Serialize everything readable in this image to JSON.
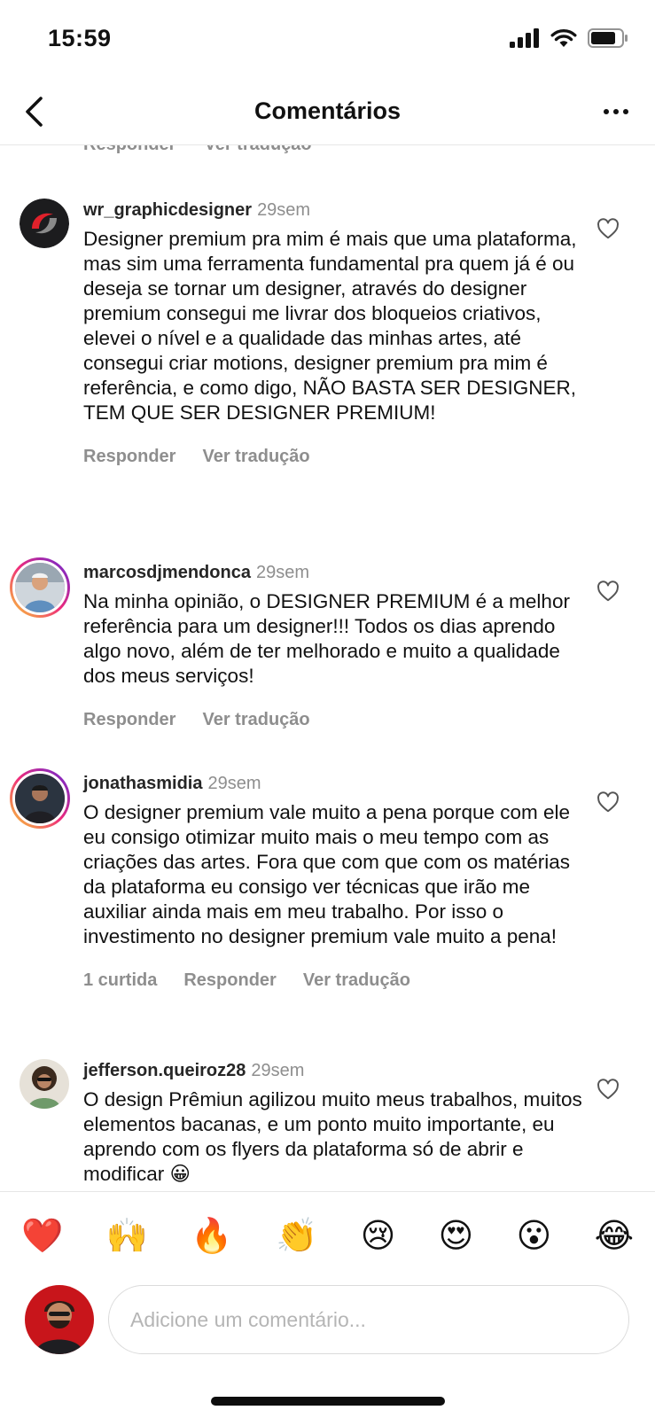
{
  "status_bar": {
    "time": "15:59"
  },
  "nav": {
    "title": "Comentários"
  },
  "previous_comment_actions": {
    "reply_label": "Responder",
    "translate_label": "Ver tradução"
  },
  "comments": [
    {
      "username": "wr_graphicdesigner",
      "time": "29sem",
      "text": "Designer premium pra mim é mais que uma plataforma, mas sim uma ferramenta fundamental pra quem já é ou deseja se tornar um designer, através do designer premium consegui me livrar dos bloqueios criativos, elevei o nível e a qualidade das minhas artes, até consegui criar motions, designer premium pra mim é referência, e como digo, NÃO BASTA SER DESIGNER, TEM QUE SER DESIGNER PREMIUM!",
      "reply_label": "Responder",
      "translate_label": "Ver tradução"
    },
    {
      "username": "marcosdjmendonca",
      "time": "29sem",
      "text": "Na minha opinião, o DESIGNER PREMIUM é a melhor referência para um designer!!! Todos os dias aprendo algo novo, além de ter melhorado e muito a qualidade dos meus serviços!",
      "reply_label": "Responder",
      "translate_label": "Ver tradução"
    },
    {
      "username": "jonathasmidia",
      "time": "29sem",
      "text": "O designer premium vale muito a pena porque com ele eu consigo otimizar muito mais o meu tempo com as criações das artes. Fora que com que com os matérias da plataforma eu consigo ver técnicas que irão me auxiliar ainda mais em meu trabalho. Por isso o investimento no designer premium vale muito a pena!",
      "likes_label": "1 curtida",
      "reply_label": "Responder",
      "translate_label": "Ver tradução"
    },
    {
      "username": "jefferson.queiroz28",
      "time": "29sem",
      "text": "O design Prêmiun agilizou muito meus trabalhos, muitos elementos bacanas, e um ponto muito importante, eu aprendo com os flyers da plataforma só de abrir e modificar 😀"
    }
  ],
  "emoji_bar": [
    "❤️",
    "🙌",
    "🔥",
    "👏",
    "😢",
    "😍",
    "😮",
    "😂"
  ],
  "input": {
    "placeholder": "Adicione um comentário..."
  }
}
